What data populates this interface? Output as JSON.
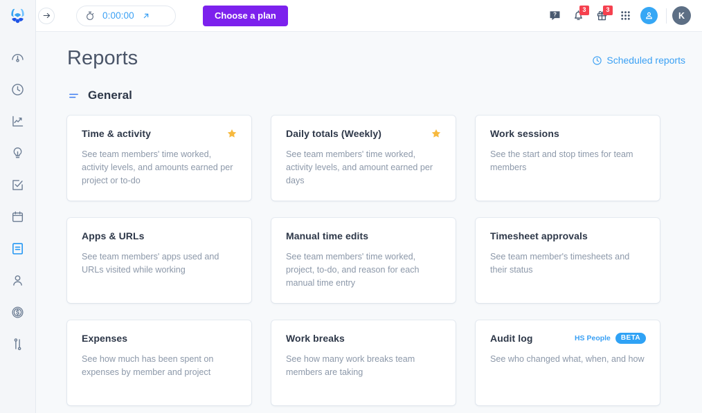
{
  "brand": {
    "logo_name": "hubstaff-logo",
    "accent": "#2196f3",
    "purple": "#7c21ed"
  },
  "topbar": {
    "collapse_icon": "arrow-right-icon",
    "timer": {
      "icon": "stopwatch-icon",
      "value": "0:00:00",
      "expand_icon": "arrow-up-right-icon"
    },
    "plan_button": "Choose a plan",
    "icons": [
      {
        "name": "help-icon",
        "badge": null
      },
      {
        "name": "bell-icon",
        "badge": "3"
      },
      {
        "name": "gift-icon",
        "badge": "3"
      },
      {
        "name": "apps-grid-icon",
        "badge": null
      }
    ],
    "person_avatar_icon": "person-circle-icon",
    "user_initial": "K"
  },
  "sidebar": {
    "items": [
      {
        "name": "sidebar-item-dashboard",
        "icon": "speedometer-icon",
        "active": false
      },
      {
        "name": "sidebar-item-timesheets",
        "icon": "clock-icon",
        "active": false
      },
      {
        "name": "sidebar-item-activity",
        "icon": "chart-line-icon",
        "active": false
      },
      {
        "name": "sidebar-item-insights",
        "icon": "lightbulb-icon",
        "active": false
      },
      {
        "name": "sidebar-item-projects",
        "icon": "checkbox-icon",
        "active": false
      },
      {
        "name": "sidebar-item-schedules",
        "icon": "calendar-icon",
        "active": false
      },
      {
        "name": "sidebar-item-reports",
        "icon": "document-icon",
        "active": true
      },
      {
        "name": "sidebar-item-people",
        "icon": "person-icon",
        "active": false
      },
      {
        "name": "sidebar-item-financials",
        "icon": "dollar-circle-icon",
        "active": false
      },
      {
        "name": "sidebar-item-settings",
        "icon": "sliders-icon",
        "active": false
      }
    ]
  },
  "page": {
    "title": "Reports",
    "scheduled_reports_label": "Scheduled reports",
    "scheduled_reports_icon": "clock-icon",
    "section": {
      "icon": "list-lines-icon",
      "title": "General"
    }
  },
  "cards": [
    {
      "title": "Time & activity",
      "desc": "See team members' time worked, activity levels, and amounts earned per project or to-do",
      "starred": true,
      "tag": null,
      "pill": null
    },
    {
      "title": "Daily totals (Weekly)",
      "desc": "See team members' time worked, activity levels, and amount earned per days",
      "starred": true,
      "tag": null,
      "pill": null
    },
    {
      "title": "Work sessions",
      "desc": "See the start and stop times for team members",
      "starred": false,
      "tag": null,
      "pill": null
    },
    {
      "title": "Apps & URLs",
      "desc": "See team members' apps used and URLs visited while working",
      "starred": false,
      "tag": null,
      "pill": null
    },
    {
      "title": "Manual time edits",
      "desc": "See team members' time worked, project, to-do, and reason for each manual time entry",
      "starred": false,
      "tag": null,
      "pill": null
    },
    {
      "title": "Timesheet approvals",
      "desc": "See team member's timesheets and their status",
      "starred": false,
      "tag": null,
      "pill": null
    },
    {
      "title": "Expenses",
      "desc": "See how much has been spent on expenses by member and project",
      "starred": false,
      "tag": null,
      "pill": null
    },
    {
      "title": "Work breaks",
      "desc": "See how many work breaks team members are taking",
      "starred": false,
      "tag": null,
      "pill": null
    },
    {
      "title": "Audit log",
      "desc": "See who changed what, when, and how",
      "starred": false,
      "tag": "HS People",
      "pill": "BETA"
    }
  ]
}
